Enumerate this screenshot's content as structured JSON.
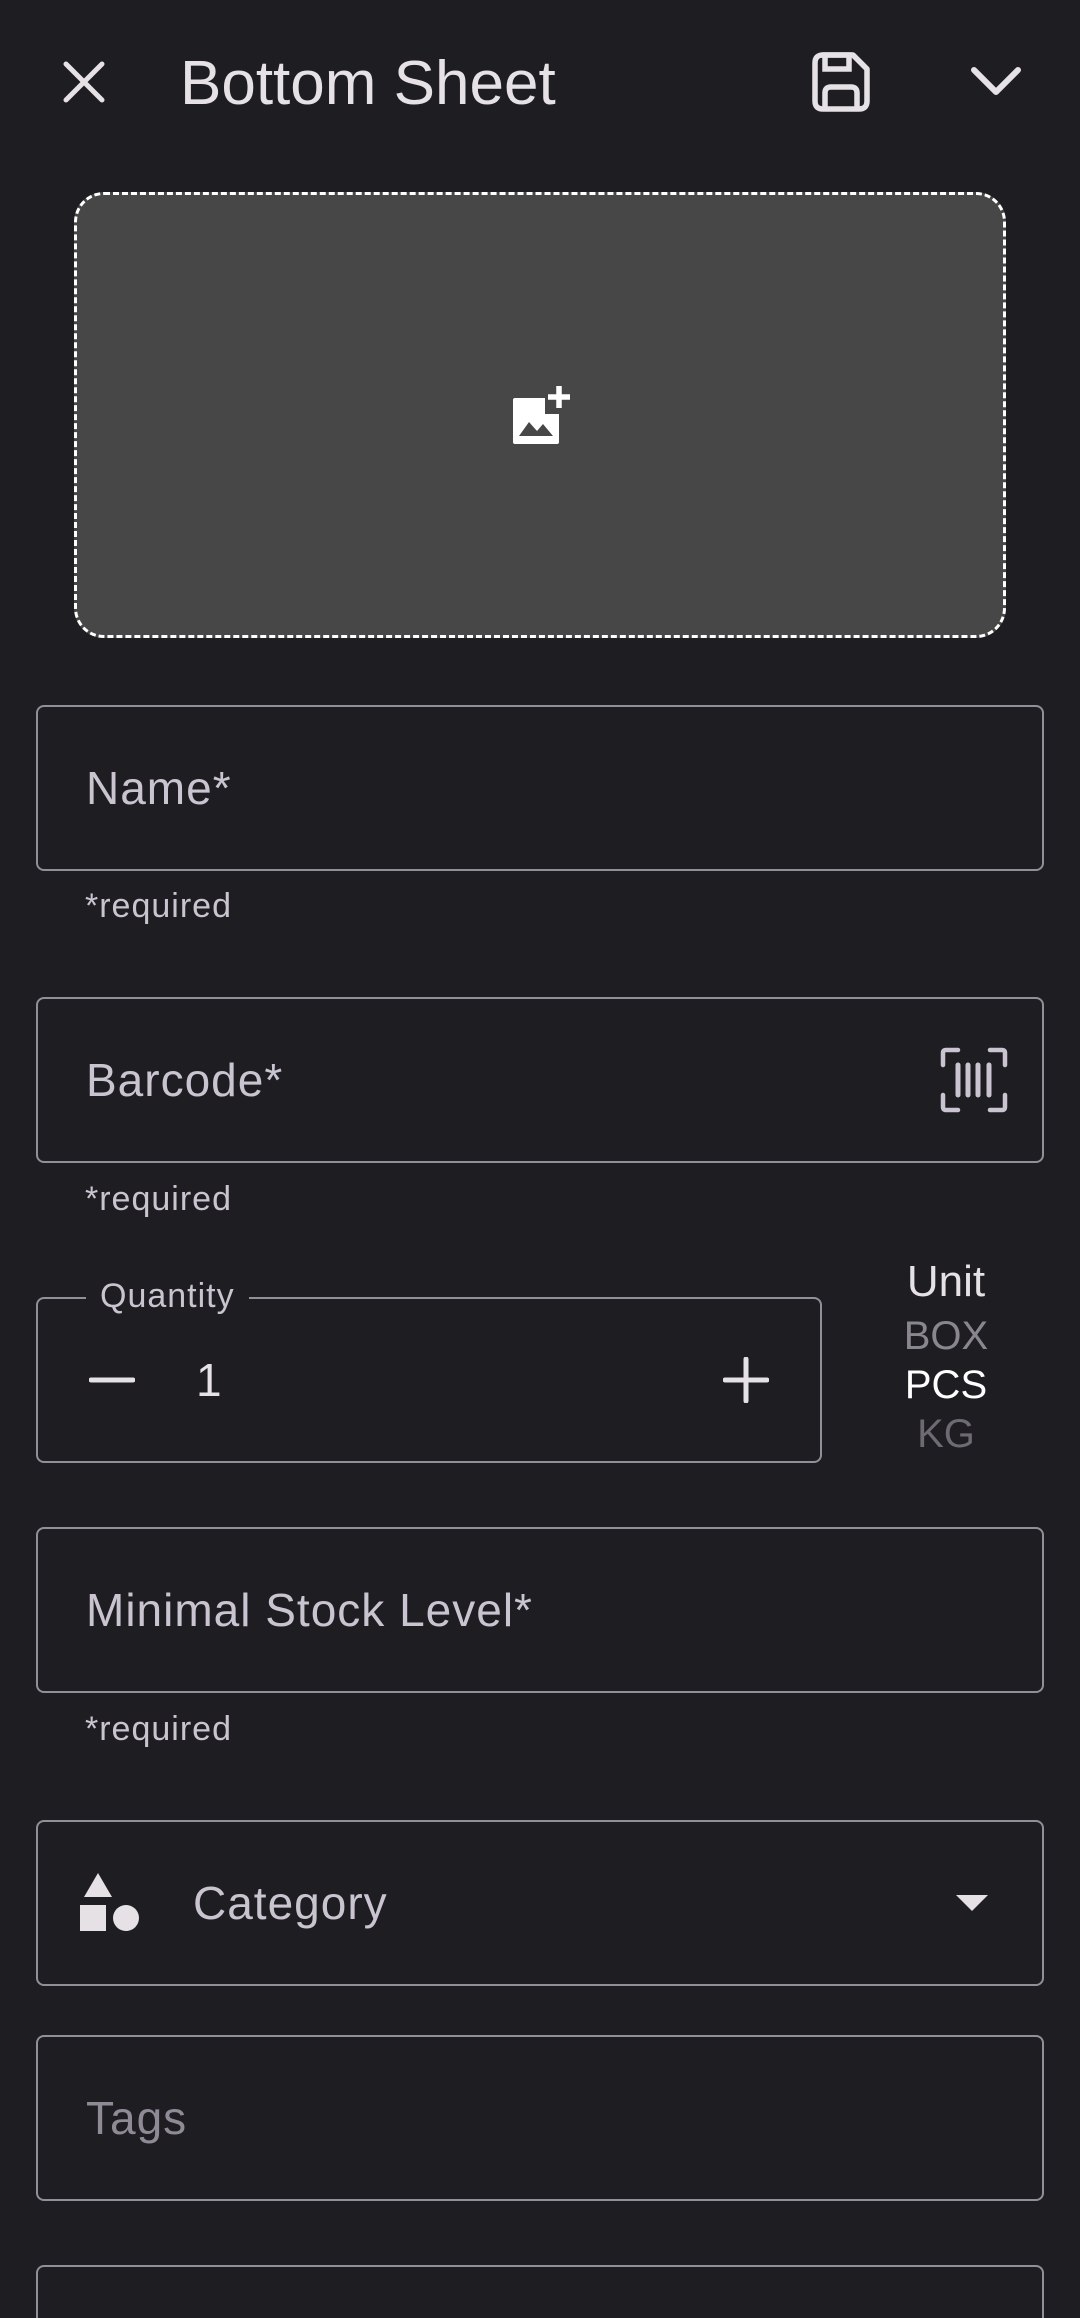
{
  "header": {
    "title": "Bottom Sheet",
    "close_icon": "close-icon",
    "save_icon": "save-icon",
    "collapse_icon": "chevron-down-icon"
  },
  "image_picker": {
    "icon": "add-photo-icon"
  },
  "fields": {
    "name": {
      "placeholder": "Name*",
      "helper": "*required"
    },
    "barcode": {
      "placeholder": "Barcode*",
      "helper": "*required",
      "icon": "barcode-scan-icon"
    },
    "quantity": {
      "label": "Quantity",
      "value": "1",
      "minus_icon": "minus-icon",
      "plus_icon": "plus-icon"
    },
    "unit": {
      "title": "Unit",
      "options": [
        "BOX",
        "PCS",
        "KG"
      ],
      "selected": "PCS"
    },
    "min_stock": {
      "placeholder": "Minimal Stock Level*",
      "helper": "*required"
    },
    "category": {
      "placeholder": "Category",
      "icon": "category-shapes-icon",
      "dropdown_icon": "dropdown-arrow-icon"
    },
    "tags": {
      "placeholder": "Tags"
    }
  },
  "colors": {
    "background": "#1e1d22",
    "outline": "#938f99",
    "image_picker_fill": "#474747",
    "text_primary": "#e6e1e5",
    "text_secondary": "#cac4d0"
  }
}
